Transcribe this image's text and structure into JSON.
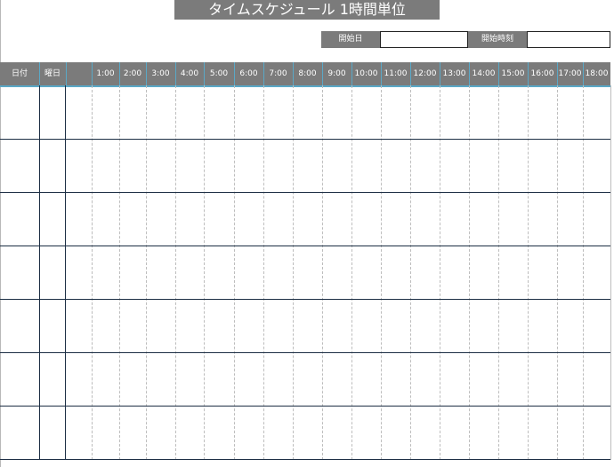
{
  "title": "タイムスケジュール 1時間単位",
  "start_date": {
    "label": "開始日",
    "value": ""
  },
  "start_time": {
    "label": "開始時刻",
    "value": ""
  },
  "header": {
    "date": "日付",
    "weekday": "曜日",
    "hours": [
      "1:00",
      "2:00",
      "3:00",
      "4:00",
      "5:00",
      "6:00",
      "7:00",
      "8:00",
      "9:00",
      "10:00",
      "11:00",
      "12:00",
      "13:00",
      "14:00",
      "15:00",
      "16:00",
      "17:00",
      "18:00"
    ]
  },
  "rows": [
    {
      "date": "",
      "weekday": ""
    },
    {
      "date": "",
      "weekday": ""
    },
    {
      "date": "",
      "weekday": ""
    },
    {
      "date": "",
      "weekday": ""
    },
    {
      "date": "",
      "weekday": ""
    },
    {
      "date": "",
      "weekday": ""
    },
    {
      "date": "",
      "weekday": ""
    }
  ],
  "colors": {
    "header_bg": "#7b7b7b",
    "header_separator": "#5aa8c6",
    "grid_line": "#1c2e44",
    "dashed_line": "#bdbdbd"
  }
}
